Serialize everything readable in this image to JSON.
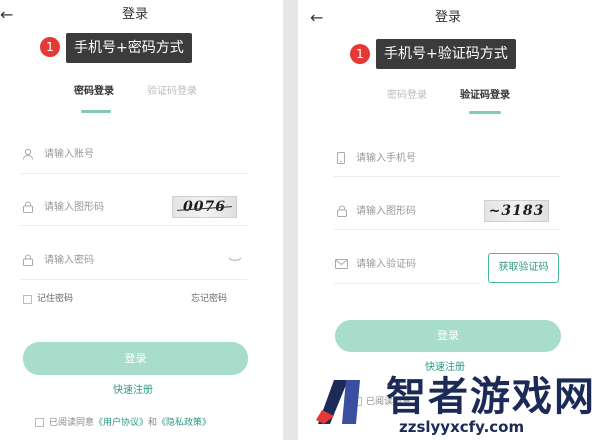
{
  "colors": {
    "accent": "#7fcdb8",
    "button": "#a8dccb",
    "link": "#2b9a86",
    "badge": "#e53935",
    "tooltip": "#3b3b3b",
    "watermark": "#1b2a57"
  },
  "left": {
    "title": "登录",
    "badge": "1",
    "tooltip": "手机号+密码方式",
    "tabs": [
      {
        "label": "密码登录",
        "active": true
      },
      {
        "label": "验证码登录",
        "active": false
      }
    ],
    "account_placeholder": "请输入账号",
    "graphic_code_placeholder": "请输入图形码",
    "captcha_text": "0076",
    "password_placeholder": "请输入密码",
    "remember_label": "记住密码",
    "forgot_label": "忘记密码",
    "login_label": "登录",
    "register_label": "快速注册",
    "agree": {
      "prefix": "已阅读同意",
      "user_agreement": "《用户协议》",
      "and": "和",
      "privacy_policy": "《隐私政策》"
    }
  },
  "right": {
    "title": "登录",
    "badge": "1",
    "tooltip": "手机号+验证码方式",
    "tabs": [
      {
        "label": "密码登录",
        "active": false
      },
      {
        "label": "验证码登录",
        "active": true
      }
    ],
    "phone_placeholder": "请输入手机号",
    "graphic_code_placeholder": "请输入图形码",
    "captcha_text": "~3183",
    "sms_code_placeholder": "请输入验证码",
    "get_code_label": "获取验证码",
    "login_label": "登录",
    "register_label": "快速注册",
    "agree_prefix": "已阅读同意"
  },
  "watermark": {
    "brand": "智者游戏网",
    "url": "zzslyyxcfy.com"
  }
}
